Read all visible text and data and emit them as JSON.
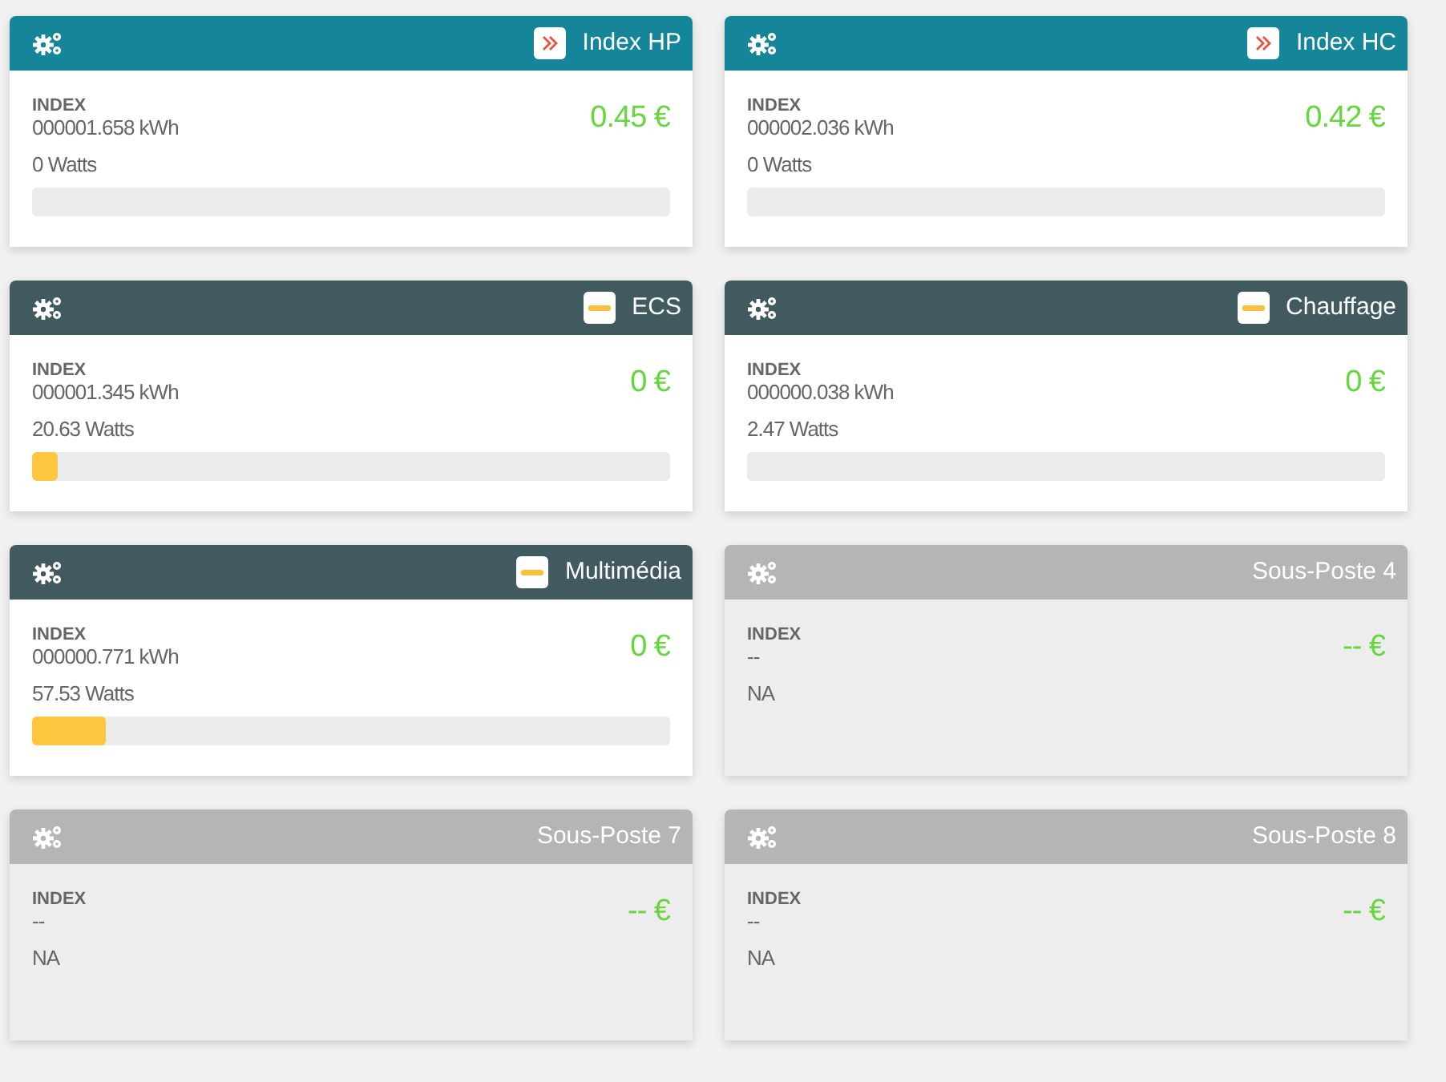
{
  "cards": [
    {
      "title": "Index HP",
      "kind": "tariff",
      "index_label": "INDEX",
      "index": "000001.658 kWh",
      "power": "0 Watts",
      "cost": "0.45 €",
      "level": 0
    },
    {
      "title": "Index HC",
      "kind": "tariff",
      "index_label": "INDEX",
      "index": "000002.036 kWh",
      "power": "0 Watts",
      "cost": "0.42 €",
      "level": 0
    },
    {
      "title": "ECS",
      "kind": "circuit",
      "index_label": "INDEX",
      "index": "000001.345 kWh",
      "power": "20.63 Watts",
      "cost": "0 €",
      "level": 0.04
    },
    {
      "title": "Chauffage",
      "kind": "circuit",
      "index_label": "INDEX",
      "index": "000000.038 kWh",
      "power": "2.47 Watts",
      "cost": "0 €",
      "level": 0
    },
    {
      "title": "Multimédia",
      "kind": "circuit",
      "index_label": "INDEX",
      "index": "000000.771 kWh",
      "power": "57.53 Watts",
      "cost": "0 €",
      "level": 0.115
    },
    {
      "title": "Sous-Poste 4",
      "kind": "unused",
      "index_label": "INDEX",
      "index": "--",
      "power": "NA",
      "cost": "-- €"
    },
    {
      "title": "Sous-Poste 7",
      "kind": "unused",
      "index_label": "INDEX",
      "index": "--",
      "power": "NA",
      "cost": "-- €"
    },
    {
      "title": "Sous-Poste 8",
      "kind": "unused",
      "index_label": "INDEX",
      "index": "--",
      "power": "NA",
      "cost": "-- €"
    }
  ]
}
